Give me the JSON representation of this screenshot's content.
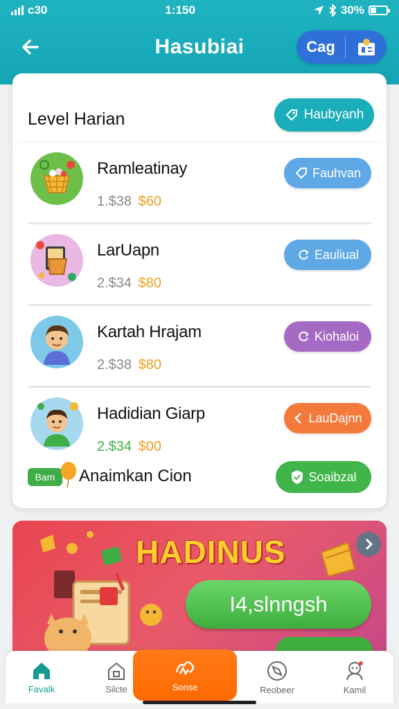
{
  "status_bar": {
    "time": "1:150",
    "carrier": "c30",
    "battery": "30%"
  },
  "header": {
    "title": "Hasubiai",
    "pill_label": "Cag"
  },
  "section": {
    "title": "Level Harian",
    "action_label": "Haubyanh"
  },
  "rows": [
    {
      "name": "Ramleatinay",
      "old_price": "1.$38",
      "new_price": "$60",
      "button": "Fauhvan",
      "button_color": "#5fa8e6"
    },
    {
      "name": "LarUapn",
      "old_price": "2.$34",
      "new_price": "$80",
      "button": "Eauliual",
      "button_color": "#5fa8e6"
    },
    {
      "name": "Kartah Hrajam",
      "old_price": "2.$38",
      "new_price": "$80",
      "button": "Kiohaloi",
      "button_color": "#a56bc4"
    },
    {
      "name": "Hadidian Giarp",
      "old_price": "2.$34",
      "new_price": "$00",
      "button": "LauDajnn",
      "button_color": "#f47a3c"
    }
  ],
  "extra": {
    "badge": "Bam",
    "label": "Anaimkan Cion",
    "button": "Soaibzal"
  },
  "banner": {
    "title": "HADINUS",
    "cta": "I4,slnngsh"
  },
  "bottom_nav": [
    {
      "label": "Favalk",
      "icon": "home-icon"
    },
    {
      "label": "Silcte",
      "icon": "store-icon"
    },
    {
      "label": "Sonse",
      "icon": "scan-icon"
    },
    {
      "label": "Reobeer",
      "icon": "compass-icon"
    },
    {
      "label": "Kamil",
      "icon": "profile-icon"
    }
  ],
  "colors": {
    "header": "#1fb3c0",
    "accent": "#1aaebb",
    "price": "#f0a020",
    "active_nav": "#129c91",
    "center_nav": "#ff6a00"
  }
}
